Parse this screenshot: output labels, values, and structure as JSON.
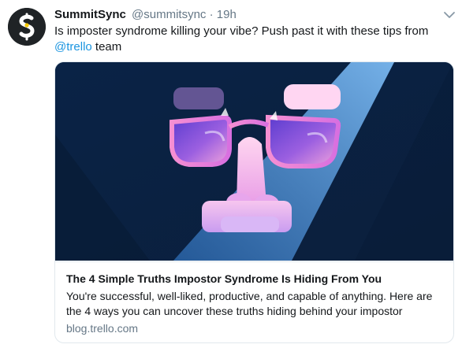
{
  "tweet": {
    "author_name": "SummitSync",
    "handle": "@summitsync",
    "separator": "·",
    "time": "19h",
    "text_before": "Is imposter syndrome killing your vibe? Push past it with these tips from ",
    "mention": "@trello",
    "text_after": " team"
  },
  "card": {
    "image_icon": "disguise-glasses-nose-illustration",
    "title": "The 4 Simple Truths Impostor Syndrome Is Hiding From You",
    "description": "You're successful, well-liked, productive, and capable of anything. Here are the 4 ways you can uncover these truths hiding behind your impostor",
    "domain": "blog.trello.com"
  },
  "icons": {
    "avatar": "summitsync-logo-icon",
    "menu": "chevron-down-icon"
  },
  "colors": {
    "link": "#1b95e0",
    "secondary_text": "#657786",
    "card_background": "#0c2b4d"
  }
}
